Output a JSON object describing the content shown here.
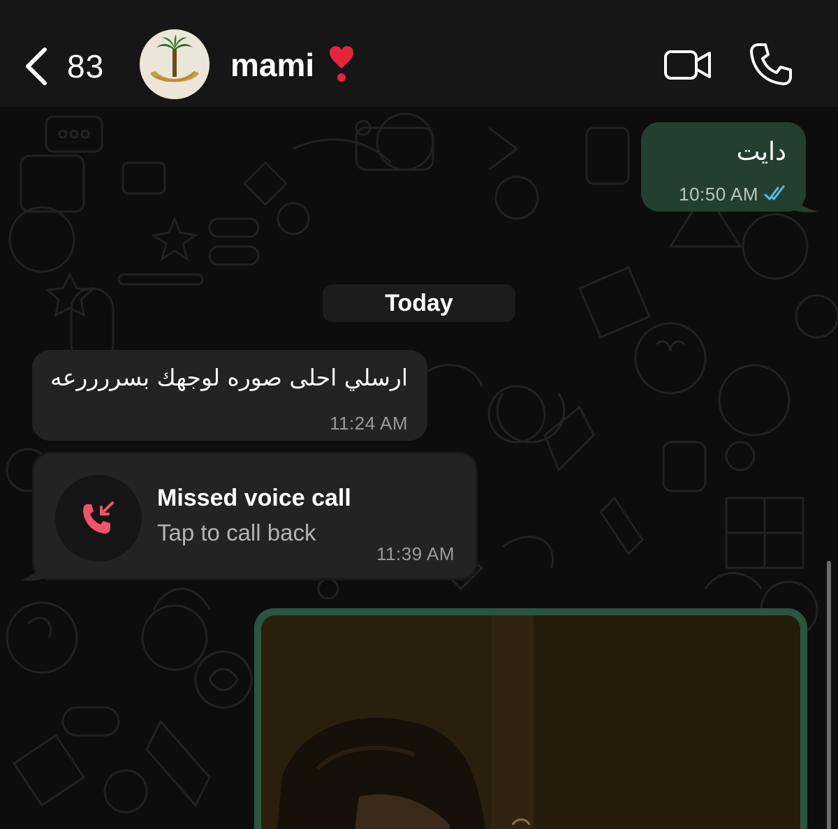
{
  "header": {
    "back_count": "83",
    "contact_name": "mami",
    "avatar_icon": "palm-swords-emblem-icon",
    "status_emoji_icon": "heart-exclamation-icon",
    "video_icon": "video-camera-icon",
    "call_icon": "phone-icon"
  },
  "messages": [
    {
      "direction": "outgoing",
      "text": "دايت",
      "time": "10:50 AM",
      "status": "read"
    },
    {
      "type": "date-separator",
      "label": "Today"
    },
    {
      "direction": "incoming",
      "text": "ارسلي احلى صوره لوجهك بسررررعه",
      "time": "11:24 AM"
    },
    {
      "direction": "incoming",
      "type": "missed-call",
      "title": "Missed voice call",
      "subtitle": "Tap to call back",
      "time": "11:39 AM"
    },
    {
      "direction": "outgoing",
      "type": "image"
    }
  ],
  "colors": {
    "outgoing_bubble": "#233f30",
    "incoming_bubble": "#232323",
    "read_ticks": "#53bdeb",
    "missed_call": "#f0546a"
  }
}
